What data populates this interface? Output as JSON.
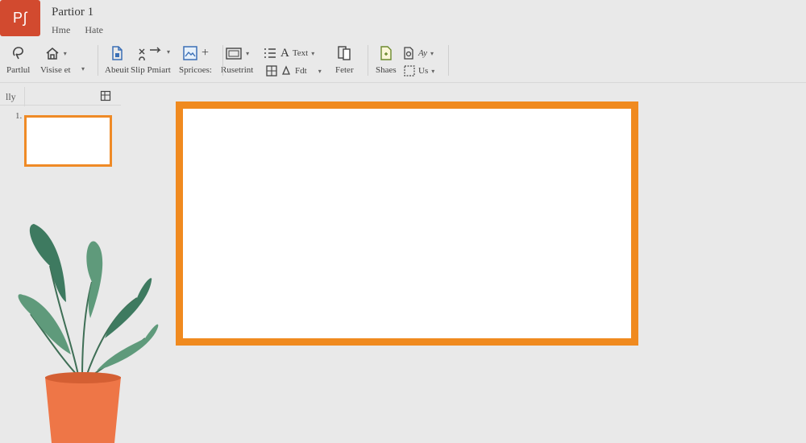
{
  "app": {
    "logo_text": "Pʃ"
  },
  "title": "Partior 1",
  "tabs": [
    "Hme",
    "Hate"
  ],
  "ribbon": {
    "items": [
      {
        "label": "Partlul",
        "icon": "lasso-select-icon"
      },
      {
        "label": "Visise et",
        "icon": "house-icon"
      },
      {
        "label": "Abeuit",
        "icon": "document-icon"
      },
      {
        "label": "Slip Pmiart",
        "icon": "layout-arrows-icon"
      },
      {
        "label": "Spricoes:",
        "icon": "picture-icon"
      },
      {
        "label": "Rusetrint",
        "icon": "layout-box-icon"
      },
      {
        "label": "Text",
        "icon": "text-icon"
      },
      {
        "label": "Fdt",
        "icon": "fill-icon"
      },
      {
        "label": "Feter",
        "icon": "arrange-icon"
      },
      {
        "label": "Shaes",
        "icon": "shapes-icon"
      },
      {
        "label": "Ay",
        "icon": "find-icon"
      },
      {
        "label": "Us",
        "icon": "select-icon"
      }
    ]
  },
  "pane": {
    "header": "lly",
    "slide_number": "1."
  },
  "colors": {
    "accent": "#f08a1f",
    "logo": "#d24a2f",
    "pot": "#ee7647",
    "leaf": "#4f8a6f"
  }
}
